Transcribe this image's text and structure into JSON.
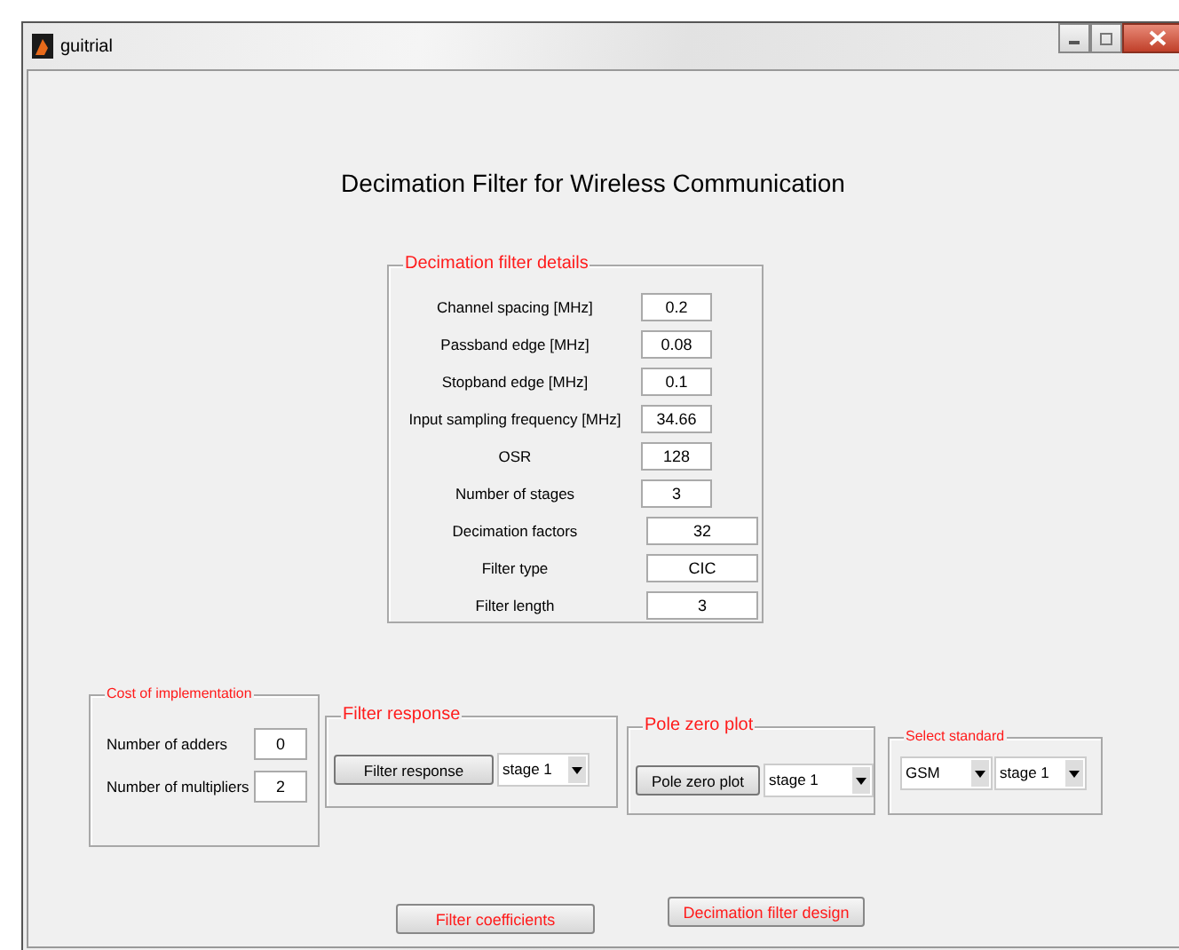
{
  "window": {
    "title": "guitrial"
  },
  "heading": "Decimation Filter for Wireless Communication",
  "details": {
    "title": "Decimation filter details",
    "rows": [
      {
        "label": "Channel spacing [MHz]",
        "value": "0.2",
        "kind": "short"
      },
      {
        "label": "Passband edge [MHz]",
        "value": "0.08",
        "kind": "short"
      },
      {
        "label": "Stopband edge [MHz]",
        "value": "0.1",
        "kind": "short"
      },
      {
        "label": "Input sampling frequency [MHz]",
        "value": "34.66",
        "kind": "short"
      },
      {
        "label": "OSR",
        "value": "128",
        "kind": "short"
      },
      {
        "label": "Number of stages",
        "value": "3",
        "kind": "short"
      },
      {
        "label": "Decimation factors",
        "value": "32",
        "kind": "long"
      },
      {
        "label": "Filter type",
        "value": "CIC",
        "kind": "long"
      },
      {
        "label": "Filter length",
        "value": "3",
        "kind": "long"
      }
    ]
  },
  "cost": {
    "title": "Cost of implementation",
    "rows": [
      {
        "label": "Number of adders",
        "value": "0"
      },
      {
        "label": "Number of multipliers",
        "value": "2"
      }
    ]
  },
  "filter_response": {
    "title": "Filter response",
    "button": "Filter response",
    "dropdown": "stage 1"
  },
  "pole_zero": {
    "title": "Pole zero plot",
    "button": "Pole zero plot",
    "dropdown": "stage 1"
  },
  "select_standard": {
    "title": "Select standard",
    "dropdowns": [
      "GSM",
      "stage 1"
    ]
  },
  "buttons": [
    "Filter coefficients",
    "Decimation filter design"
  ]
}
